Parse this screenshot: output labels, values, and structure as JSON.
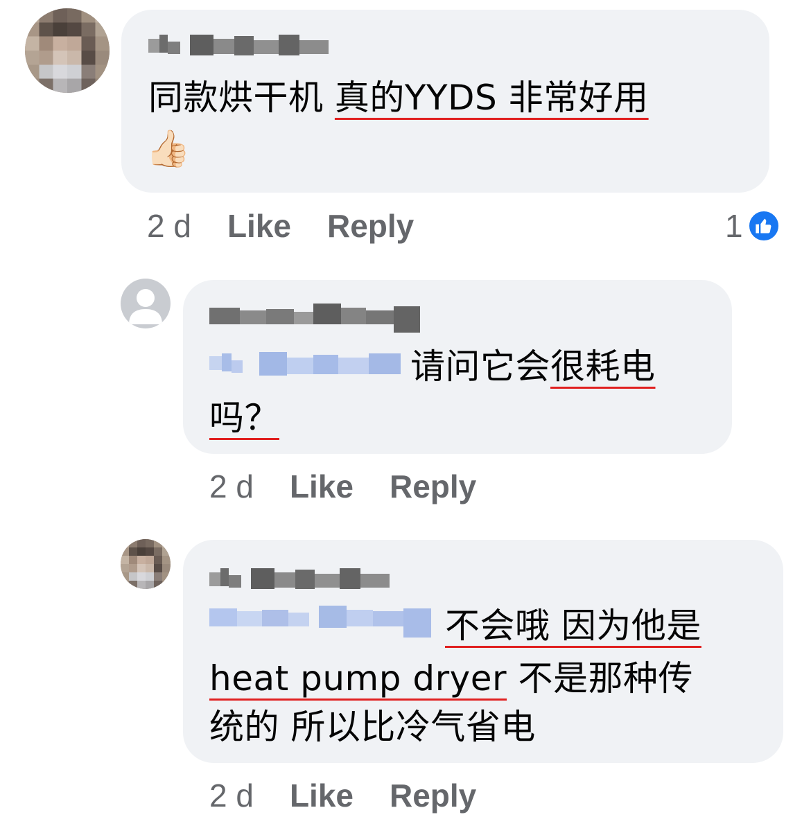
{
  "comments": [
    {
      "author_blurred": "[blurred name]",
      "text_plain": "同款烘干机 ",
      "text_underlined": "真的YYDS 非常好用",
      "emoji": "👍🏻",
      "time": "2 d",
      "like_label": "Like",
      "reply_label": "Reply",
      "reaction_count": "1"
    },
    {
      "author_blurred": "[blurred name]",
      "mention_blurred": "[blurred mention]",
      "text_plain": "请问它会",
      "text_underlined_1": "很耗电",
      "text_underlined_2": "吗？",
      "time": "2 d",
      "like_label": "Like",
      "reply_label": "Reply"
    },
    {
      "author_blurred": "[blurred name]",
      "mention_blurred": "[blurred mention]",
      "text_underlined_1": "不会哦 因为他是",
      "text_underlined_2": "heat pump dryer",
      "text_plain_2": " 不是那种传",
      "text_plain_3": "统的 所以比冷气省电",
      "time": "2 d",
      "like_label": "Like",
      "reply_label": "Reply"
    }
  ],
  "colors": {
    "bubble": "#f0f2f5",
    "meta_text": "#65676b",
    "underline": "#e02020",
    "like_badge": "#1877f2",
    "mention": "#b8ccf0"
  },
  "icons": {
    "reaction": "thumbs-up-icon",
    "avatar_default": "default-user-icon"
  }
}
